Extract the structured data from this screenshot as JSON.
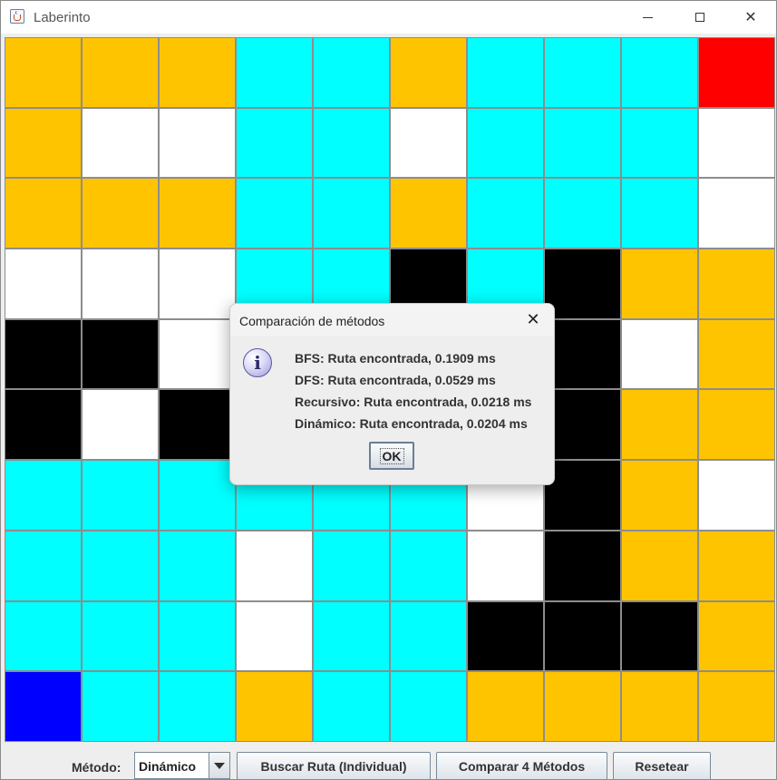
{
  "window": {
    "title": "Laberinto",
    "controls": {
      "minimize_icon": "minimize-icon",
      "maximize_icon": "maximize-icon",
      "close_icon": "close-icon",
      "close_glyph": "✕"
    }
  },
  "colors": {
    "Y": "#ffc400",
    "C": "#00ffff",
    "W": "#ffffff",
    "B": "#000000",
    "R": "#ff0000",
    "D": "#0000ff"
  },
  "maze": {
    "rows": [
      [
        "Y",
        "Y",
        "Y",
        "C",
        "C",
        "Y",
        "C",
        "C",
        "C",
        "R"
      ],
      [
        "Y",
        "W",
        "W",
        "C",
        "C",
        "W",
        "C",
        "C",
        "C",
        "W"
      ],
      [
        "Y",
        "Y",
        "Y",
        "C",
        "C",
        "Y",
        "C",
        "C",
        "C",
        "W"
      ],
      [
        "W",
        "W",
        "W",
        "C",
        "C",
        "B",
        "C",
        "B",
        "Y",
        "Y"
      ],
      [
        "B",
        "B",
        "W",
        "W",
        "W",
        "W",
        "W",
        "B",
        "W",
        "Y"
      ],
      [
        "B",
        "W",
        "B",
        "W",
        "W",
        "W",
        "W",
        "B",
        "Y",
        "Y"
      ],
      [
        "C",
        "C",
        "C",
        "C",
        "C",
        "C",
        "W",
        "B",
        "Y",
        "W"
      ],
      [
        "C",
        "C",
        "C",
        "W",
        "C",
        "C",
        "W",
        "B",
        "Y",
        "Y"
      ],
      [
        "C",
        "C",
        "C",
        "W",
        "C",
        "C",
        "B",
        "B",
        "B",
        "Y"
      ],
      [
        "D",
        "C",
        "C",
        "Y",
        "C",
        "C",
        "Y",
        "Y",
        "Y",
        "Y"
      ]
    ]
  },
  "controls": {
    "metodo_label": "Método:",
    "method_selected": "Dinámico",
    "buscar_label": "Buscar Ruta (Individual)",
    "comparar_label": "Comparar 4 Métodos",
    "reset_label": "Resetear"
  },
  "dialog": {
    "title": "Comparación de métodos",
    "icon": "info-icon",
    "messages": [
      "BFS: Ruta encontrada, 0.1909 ms",
      "DFS: Ruta encontrada, 0.0529 ms",
      "Recursivo: Ruta encontrada, 0.0218 ms",
      "Dinámico: Ruta encontrada, 0.0204 ms"
    ],
    "ok_label": "OK",
    "close_glyph": "✕"
  }
}
